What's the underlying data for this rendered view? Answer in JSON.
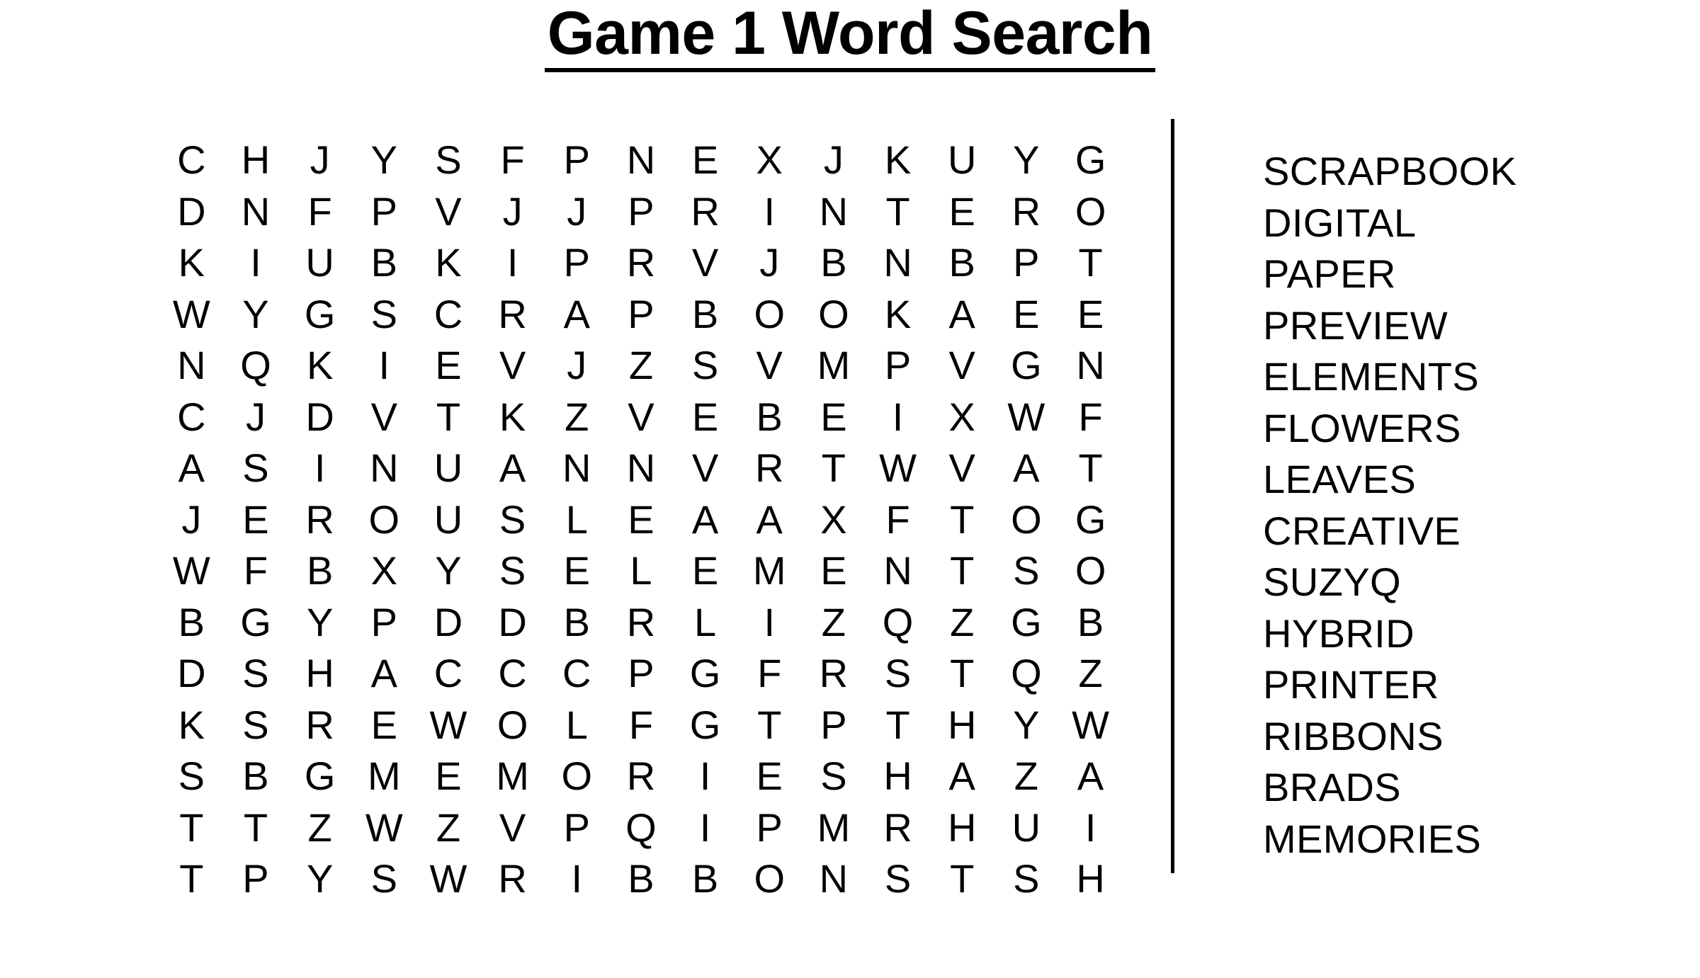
{
  "title": "Game 1 Word Search",
  "puzzle": {
    "rows": 15,
    "cols": 15,
    "grid": [
      [
        "C",
        "H",
        "J",
        "Y",
        "S",
        "F",
        "P",
        "N",
        "E",
        "X",
        "J",
        "K",
        "U",
        "Y",
        "G"
      ],
      [
        "D",
        "N",
        "F",
        "P",
        "V",
        "J",
        "J",
        "P",
        "R",
        "I",
        "N",
        "T",
        "E",
        "R",
        "O"
      ],
      [
        "K",
        "I",
        "U",
        "B",
        "K",
        "I",
        "P",
        "R",
        "V",
        "J",
        "B",
        "N",
        "B",
        "P",
        "T"
      ],
      [
        "W",
        "Y",
        "G",
        "S",
        "C",
        "R",
        "A",
        "P",
        "B",
        "O",
        "O",
        "K",
        "A",
        "E",
        "E"
      ],
      [
        "N",
        "Q",
        "K",
        "I",
        "E",
        "V",
        "J",
        "Z",
        "S",
        "V",
        "M",
        "P",
        "V",
        "G",
        "N"
      ],
      [
        "C",
        "J",
        "D",
        "V",
        "T",
        "K",
        "Z",
        "V",
        "E",
        "B",
        "E",
        "I",
        "X",
        "W",
        "F"
      ],
      [
        "A",
        "S",
        "I",
        "N",
        "U",
        "A",
        "N",
        "N",
        "V",
        "R",
        "T",
        "W",
        "V",
        "A",
        "T"
      ],
      [
        "J",
        "E",
        "R",
        "O",
        "U",
        "S",
        "L",
        "E",
        "A",
        "A",
        "X",
        "F",
        "T",
        "O",
        "G"
      ],
      [
        "W",
        "F",
        "B",
        "X",
        "Y",
        "S",
        "E",
        "L",
        "E",
        "M",
        "E",
        "N",
        "T",
        "S",
        "O"
      ],
      [
        "B",
        "G",
        "Y",
        "P",
        "D",
        "D",
        "B",
        "R",
        "L",
        "I",
        "Z",
        "Q",
        "Z",
        "G",
        "B"
      ],
      [
        "D",
        "S",
        "H",
        "A",
        "C",
        "C",
        "C",
        "P",
        "G",
        "F",
        "R",
        "S",
        "T",
        "Q",
        "Z"
      ],
      [
        "K",
        "S",
        "R",
        "E",
        "W",
        "O",
        "L",
        "F",
        "G",
        "T",
        "P",
        "T",
        "H",
        "Y",
        "W"
      ],
      [
        "S",
        "B",
        "G",
        "M",
        "E",
        "M",
        "O",
        "R",
        "I",
        "E",
        "S",
        "H",
        "A",
        "Z",
        "A"
      ],
      [
        "T",
        "T",
        "Z",
        "W",
        "Z",
        "V",
        "P",
        "Q",
        "I",
        "P",
        "M",
        "R",
        "H",
        "U",
        "I"
      ],
      [
        "T",
        "P",
        "Y",
        "S",
        "W",
        "R",
        "I",
        "B",
        "B",
        "O",
        "N",
        "S",
        "T",
        "S",
        "H"
      ]
    ]
  },
  "wordlist": {
    "words": [
      "SCRAPBOOK",
      "DIGITAL",
      "PAPER",
      "PREVIEW",
      "ELEMENTS",
      "FLOWERS",
      "LEAVES",
      "CREATIVE",
      "SUZYQ",
      "HYBRID",
      "PRINTER",
      "RIBBONS",
      "BRADS",
      "MEMORIES"
    ]
  },
  "colors": {
    "text": "#000000",
    "background": "#ffffff",
    "divider": "#000000"
  }
}
